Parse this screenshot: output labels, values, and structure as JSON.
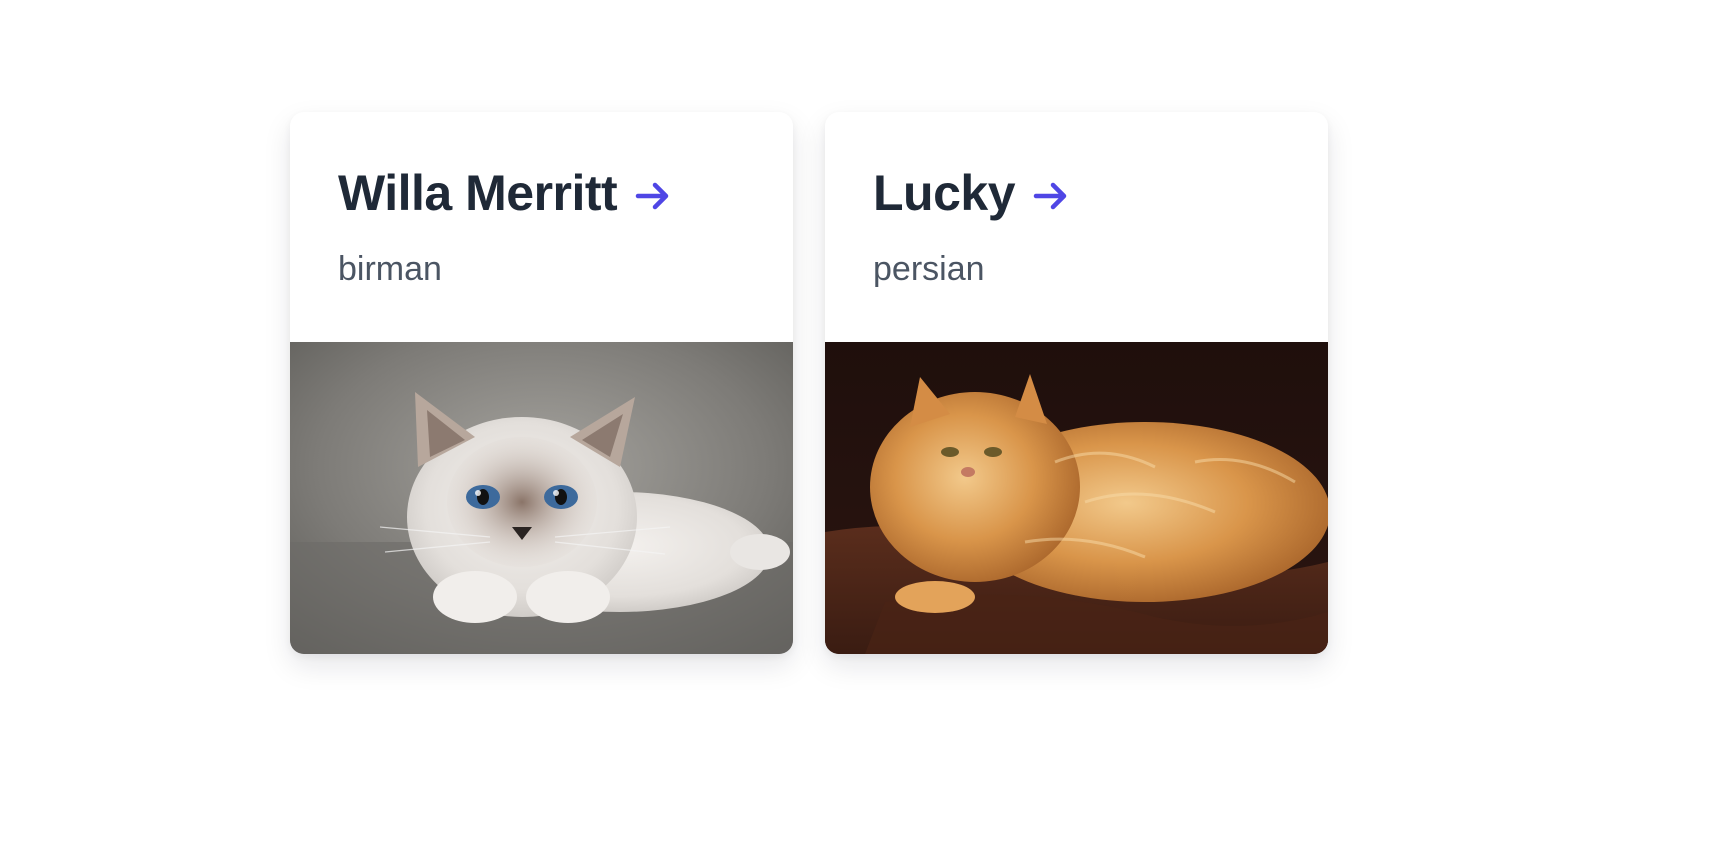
{
  "cards": [
    {
      "name": "Willa Merritt",
      "breed": "birman",
      "arrow_icon": "arrow-right-icon",
      "image_alt": "birman cat photo",
      "accent_color": "#4f46e5"
    },
    {
      "name": "Lucky",
      "breed": "persian",
      "arrow_icon": "arrow-right-icon",
      "image_alt": "persian cat photo",
      "accent_color": "#4f46e5"
    }
  ],
  "colors": {
    "title": "#1f2937",
    "subtitle": "#4b5563",
    "accent": "#4f46e5"
  }
}
